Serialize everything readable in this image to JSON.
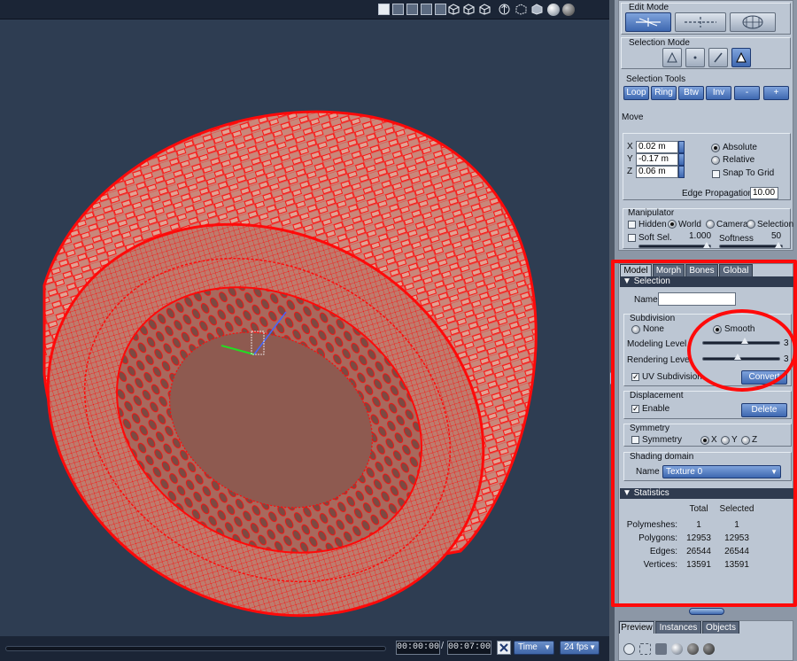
{
  "viewport": {
    "layout_icons": [
      "single-view-icon",
      "four-view-icon",
      "two-view-icon",
      "three-view-icon",
      "side-view-icon"
    ],
    "view_icons": [
      "display-mode-icon",
      "wireframe-mode-icon",
      "shaded-mode-icon",
      "move-view-icon",
      "bounding-box-icon",
      "solid-cube-icon",
      "shaded-sphere-icon",
      "gray-sphere-icon"
    ],
    "mesh_color": "#ff0a0a",
    "surface_color": "#c9877a",
    "background_color": "#2e3d52"
  },
  "timeline": {
    "current_time": "00:00:00",
    "separator": "/",
    "end_time": "00:07:00",
    "time_mode": "Time",
    "fps": "24 fps"
  },
  "edit_mode": {
    "title": "Edit Mode",
    "buttons": [
      "edit-mesh",
      "edit-move",
      "edit-sculpt"
    ],
    "active_index": 0
  },
  "selection_mode": {
    "title": "Selection Mode",
    "buttons": [
      "vertex",
      "point",
      "edge",
      "polygon"
    ],
    "active_index": 3
  },
  "selection_tools": {
    "title": "Selection Tools",
    "buttons": [
      "Loop",
      "Ring",
      "Btw",
      "Inv",
      "-",
      "+"
    ]
  },
  "move": {
    "title": "Move",
    "x_label": "X",
    "x_value": "0.02 m",
    "y_label": "Y",
    "y_value": "-0.17 m",
    "z_label": "Z",
    "z_value": "0.06 m",
    "absolute": "Absolute",
    "relative": "Relative",
    "snap": "Snap To Grid",
    "edge_propagation_label": "Edge Propagation",
    "edge_propagation_value": "10.00"
  },
  "manipulator": {
    "title": "Manipulator",
    "hidden": "Hidden",
    "world": "World",
    "camera": "Camera",
    "selection": "Selection",
    "soft_sel_label": "Soft Sel.",
    "soft_sel_value": "1.000",
    "softness_label": "Softness",
    "softness_value": "50"
  },
  "tabs": [
    "Model",
    "Morph",
    "Bones",
    "Global"
  ],
  "selection_section": {
    "title": "Selection",
    "name_label": "Name",
    "name_value": ""
  },
  "subdivision": {
    "title": "Subdivision",
    "none": "None",
    "smooth": "Smooth",
    "modeling_level_label": "Modeling Level",
    "modeling_level_value": "3",
    "modeling_level": 0.55,
    "rendering_level_label": "Rendering Level",
    "rendering_level_value": "3",
    "rendering_level": 0.45,
    "uv_subdivision": "UV Subdivision",
    "convert": "Convert"
  },
  "displacement": {
    "title": "Displacement",
    "enable": "Enable",
    "delete": "Delete"
  },
  "symmetry": {
    "title": "Symmetry",
    "symmetry": "Symmetry",
    "x": "X",
    "y": "Y",
    "z": "Z"
  },
  "shading_domain": {
    "title": "Shading domain",
    "name_label": "Name",
    "name_value": "Texture 0"
  },
  "statistics": {
    "title": "Statistics",
    "col_total": "Total",
    "col_selected": "Selected",
    "rows": [
      {
        "label": "Polymeshes:",
        "total": "1",
        "selected": "1"
      },
      {
        "label": "Polygons:",
        "total": "12953",
        "selected": "12953"
      },
      {
        "label": "Edges:",
        "total": "26544",
        "selected": "26544"
      },
      {
        "label": "Vertices:",
        "total": "13591",
        "selected": "13591"
      }
    ]
  },
  "bottom_tabs": [
    "Preview",
    "Instances",
    "Objects"
  ],
  "annotation_color": "#ff0a0a"
}
